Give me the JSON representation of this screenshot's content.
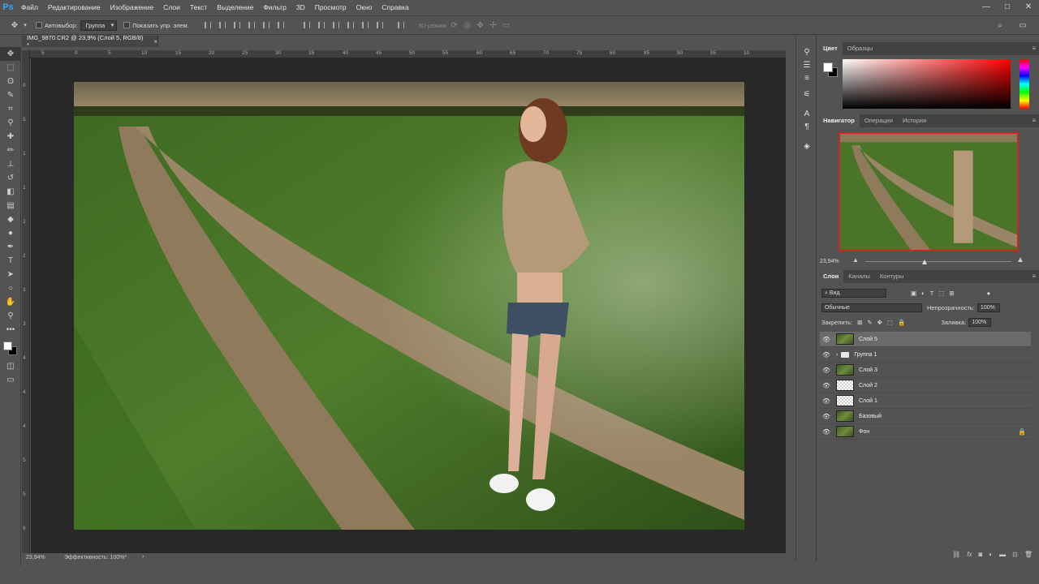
{
  "app": {
    "logo": "Ps"
  },
  "menu": [
    "Файл",
    "Редактирование",
    "Изображение",
    "Слои",
    "Текст",
    "Выделение",
    "Фильтр",
    "3D",
    "Просмотр",
    "Окно",
    "Справка"
  ],
  "window_controls": [
    "—",
    "□",
    "✕"
  ],
  "options": {
    "autoselect_label": "Автовыбор:",
    "autoselect_value": "Группа",
    "show_transform_label": "Показать упр. элем.",
    "mode3d_label": "3D-режим:"
  },
  "document": {
    "tab_title": "IMG_9870.CR2 @ 23,9% (Слой 5, RGB/8) *",
    "close": "×"
  },
  "ruler": {
    "top": [
      "5",
      "0",
      "5",
      "10",
      "15",
      "20",
      "25",
      "30",
      "35",
      "40",
      "45",
      "50",
      "55",
      "60",
      "65",
      "70",
      "75",
      "80",
      "85",
      "90",
      "95",
      "10"
    ],
    "left": [
      "0",
      "5",
      "1",
      "1",
      "2",
      "2",
      "3",
      "3",
      "4",
      "4",
      "4",
      "5",
      "5",
      "6"
    ]
  },
  "status": {
    "zoom": "23,94%",
    "efficiency": "Эффективность: 100%*",
    "arrow": "›"
  },
  "color_panel": {
    "tabs": [
      "Цвет",
      "Образцы"
    ]
  },
  "navigator_panel": {
    "tabs": [
      "Навигатор",
      "Операции",
      "История"
    ],
    "zoom": "23,94%"
  },
  "layers_panel": {
    "tabs": [
      "Слои",
      "Каналы",
      "Контуры"
    ],
    "filter_label": "Вид",
    "blend_mode": "Обычные",
    "opacity_label": "Непрозрачность:",
    "opacity_value": "100%",
    "lock_label": "Закрепить:",
    "fill_label": "Заливка:",
    "fill_value": "100%",
    "layers": [
      {
        "name": "Слой 5",
        "thumb": "img",
        "selected": true
      },
      {
        "name": "Группа 1",
        "thumb": "folder"
      },
      {
        "name": "Слой 3",
        "thumb": "img"
      },
      {
        "name": "Слой 2",
        "thumb": "trans"
      },
      {
        "name": "Слой 1",
        "thumb": "trans"
      },
      {
        "name": "Базовый",
        "thumb": "img"
      },
      {
        "name": "Фон",
        "thumb": "img",
        "locked": true
      }
    ],
    "footer_icons": [
      "link-icon",
      "fx-icon",
      "mask-icon",
      "adjustment-icon",
      "folder-icon",
      "new-layer-icon",
      "trash-icon"
    ],
    "footer_fx": "fx"
  },
  "colors": {
    "accent": "#31a8ff",
    "nav_frame": "#d02424",
    "canvas_bg": "#282828"
  }
}
